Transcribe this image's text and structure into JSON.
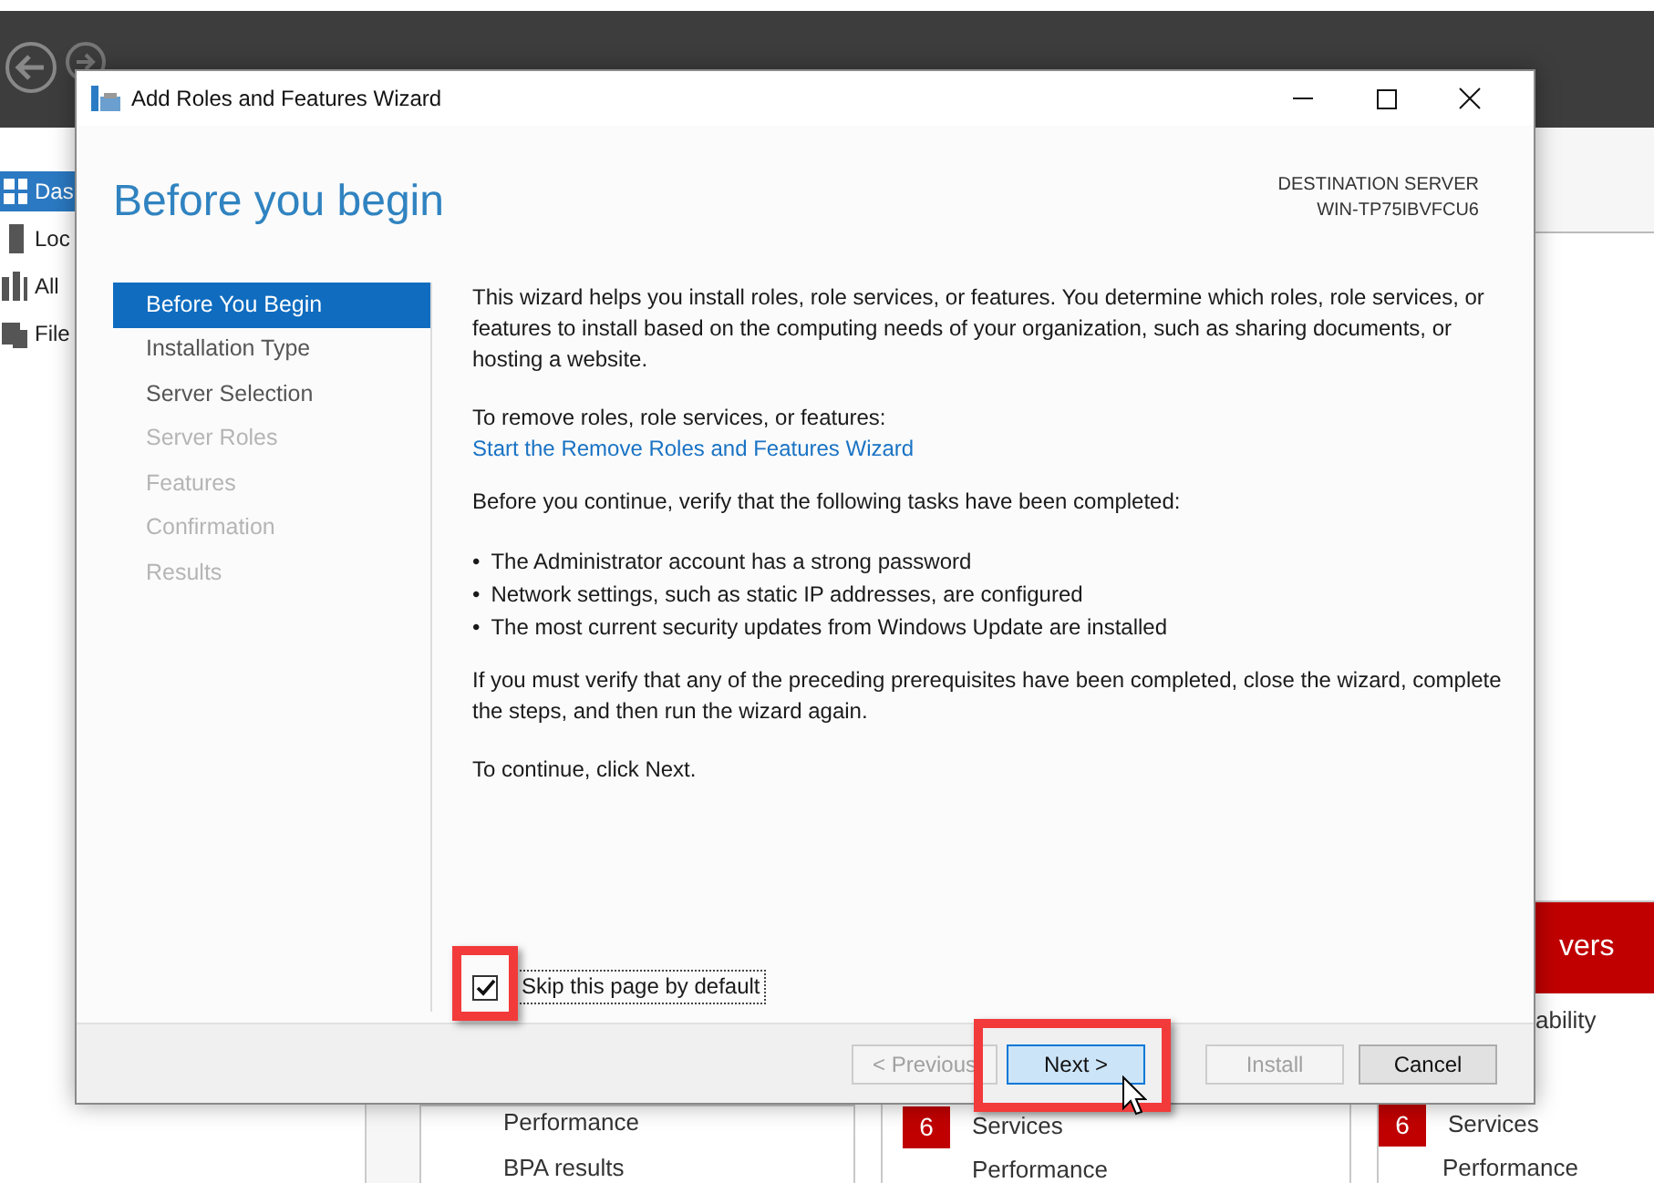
{
  "background_app": {
    "sidebar_items": [
      {
        "label": "Das",
        "selected": true
      },
      {
        "label": "Loc",
        "selected": false
      },
      {
        "label": "All",
        "selected": false
      },
      {
        "label": "File",
        "selected": false
      }
    ],
    "tiles": [
      {
        "rows": [
          {
            "label": "Performance"
          },
          {
            "label": "BPA results"
          }
        ]
      },
      {
        "rows": [
          {
            "count": "6",
            "label": "Services"
          },
          {
            "label": "Performance"
          }
        ]
      },
      {
        "header": "vers",
        "rows": [
          {
            "label": "ability"
          },
          {
            "count": "6",
            "label": "Services"
          },
          {
            "label": "Performance"
          }
        ]
      }
    ]
  },
  "dialog": {
    "title": "Add Roles and Features Wizard",
    "heading": "Before you begin",
    "destination_label": "DESTINATION SERVER",
    "destination_server": "WIN-TP75IBVFCU6",
    "steps": [
      {
        "label": "Before You Begin",
        "selected": true,
        "disabled": false
      },
      {
        "label": "Installation Type",
        "selected": false,
        "disabled": false
      },
      {
        "label": "Server Selection",
        "selected": false,
        "disabled": false
      },
      {
        "label": "Server Roles",
        "selected": false,
        "disabled": true
      },
      {
        "label": "Features",
        "selected": false,
        "disabled": true
      },
      {
        "label": "Confirmation",
        "selected": false,
        "disabled": true
      },
      {
        "label": "Results",
        "selected": false,
        "disabled": true
      }
    ],
    "content": [
      {
        "kind": "paragraph",
        "text": "This wizard helps you install roles, role services, or features. You determine which roles, role services, or features to install based on the computing needs of your organization, such as sharing documents, or hosting a website."
      },
      {
        "kind": "paragraph",
        "text": "To remove roles, role services, or features:",
        "link": "Start the Remove Roles and Features Wizard"
      },
      {
        "kind": "paragraph",
        "text": "Before you continue, verify that the following tasks have been completed:"
      },
      {
        "kind": "bullets",
        "bullet": "•",
        "items": [
          "The Administrator account has a strong password",
          "Network settings, such as static IP addresses, are configured",
          "The most current security updates from Windows Update are installed"
        ]
      },
      {
        "kind": "paragraph",
        "text": "If you must verify that any of the preceding prerequisites have been completed, close the wizard, complete the steps, and then run the wizard again."
      },
      {
        "kind": "paragraph",
        "text": "To continue, click Next."
      }
    ],
    "skip_checkbox": {
      "label": "Skip this page by default",
      "checked": true,
      "highlighted": true
    },
    "buttons": [
      {
        "label": "< Previous",
        "disabled": true,
        "hover": false,
        "highlighted": false
      },
      {
        "label": "Next >",
        "disabled": false,
        "hover": true,
        "highlighted": true
      },
      {
        "label": "Install",
        "disabled": true,
        "hover": false,
        "highlighted": false
      },
      {
        "label": "Cancel",
        "disabled": false,
        "hover": false,
        "highlighted": false
      }
    ]
  }
}
